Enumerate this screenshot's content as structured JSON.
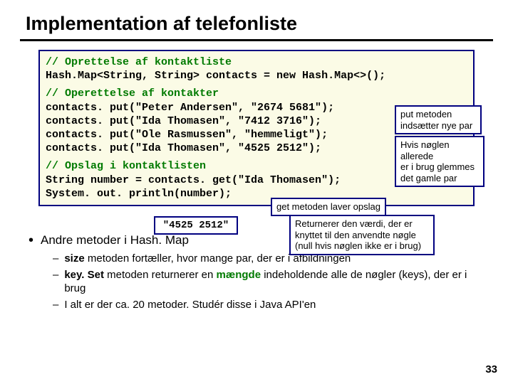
{
  "title": "Implementation af telefonliste",
  "code": {
    "c1": "// Oprettelse af kontaktliste",
    "l1": "Hash.Map<String, String> contacts = new Hash.Map<>();",
    "c2": "// Operettelse af kontakter",
    "l2": "contacts. put(\"Peter Andersen\", \"2674 5681\");",
    "l3": "contacts. put(\"Ida Thomasen\", \"7412 3716\");",
    "l4": "contacts. put(\"Ole Rasmussen\", \"hemmeligt\");",
    "l5": "contacts. put(\"Ida Thomasen\", \"4525 2512\");",
    "c3": "// Opslag i kontaktlisten",
    "l6": "String number = contacts. get(\"Ida Thomasen\");",
    "l7": "System. out. println(number);"
  },
  "valuebox": "\"4525 2512\"",
  "annot": {
    "get": "get metoden laver opslag",
    "put1a": "put metoden",
    "put1b": "indsætter nye par",
    "put2a": "Hvis nøglen allerede",
    "put2b": "er i brug glemmes",
    "put2c": "det gamle par",
    "ret1": "Returnerer den værdi, der er",
    "ret2": "knyttet til den anvendte nøgle",
    "ret3": "(null hvis nøglen ikke er i brug)"
  },
  "bullets": {
    "top": "Andre metoder i Hash. Map",
    "s1a": "size",
    "s1b": " metoden fortæller, hvor mange par, der er i afbildningen",
    "s2a": "key. Set",
    "s2b": " metoden returnerer en ",
    "s2c": "mængde",
    "s2d": " indeholdende alle de nøgler (keys), der er i brug",
    "s3": "I alt er der ca. 20 metoder. Studér disse i Java API'en"
  },
  "pagenum": "33",
  "chart_data": {
    "type": "table",
    "note": "not-a-chart"
  }
}
